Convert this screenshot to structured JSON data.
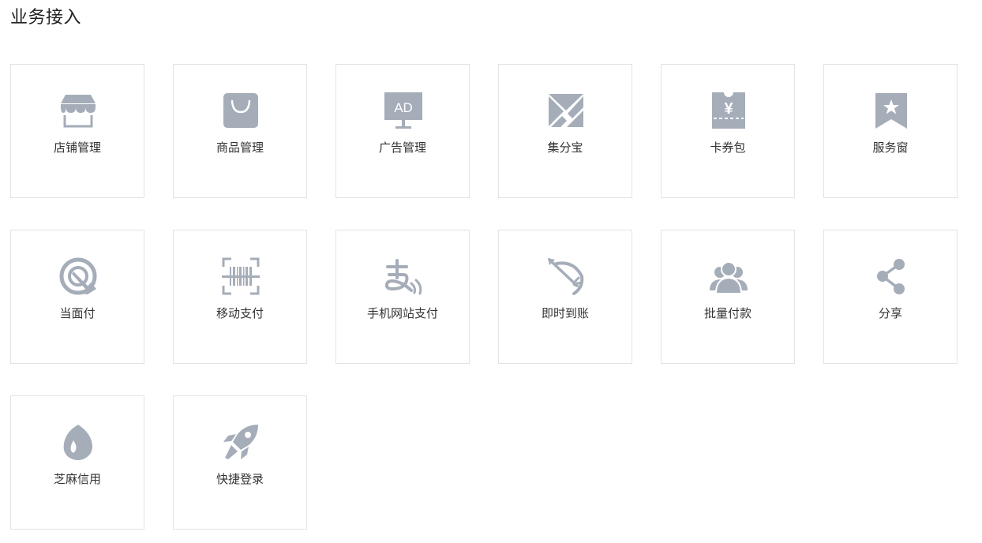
{
  "page": {
    "title": "业务接入"
  },
  "colors": {
    "icon": "#a5adb9",
    "border": "#e3e3e3",
    "text": "#333333"
  },
  "cards": [
    {
      "label": "店铺管理",
      "icon": "store-icon"
    },
    {
      "label": "商品管理",
      "icon": "shopping-bag-icon"
    },
    {
      "label": "广告管理",
      "icon": "ad-monitor-icon",
      "icon_text": "AD"
    },
    {
      "label": "集分宝",
      "icon": "jifenbao-icon"
    },
    {
      "label": "卡券包",
      "icon": "coupon-icon",
      "icon_text": "¥"
    },
    {
      "label": "服务窗",
      "icon": "bookmark-star-icon"
    },
    {
      "label": "当面付",
      "icon": "tap-pay-icon"
    },
    {
      "label": "移动支付",
      "icon": "barcode-scan-icon"
    },
    {
      "label": "手机网站支付",
      "icon": "alipay-wave-icon"
    },
    {
      "label": "即时到账",
      "icon": "bow-arrow-icon"
    },
    {
      "label": "批量付款",
      "icon": "user-group-icon"
    },
    {
      "label": "分享",
      "icon": "share-icon"
    },
    {
      "label": "芝麻信用",
      "icon": "sesame-drop-icon"
    },
    {
      "label": "快捷登录",
      "icon": "rocket-icon"
    }
  ]
}
